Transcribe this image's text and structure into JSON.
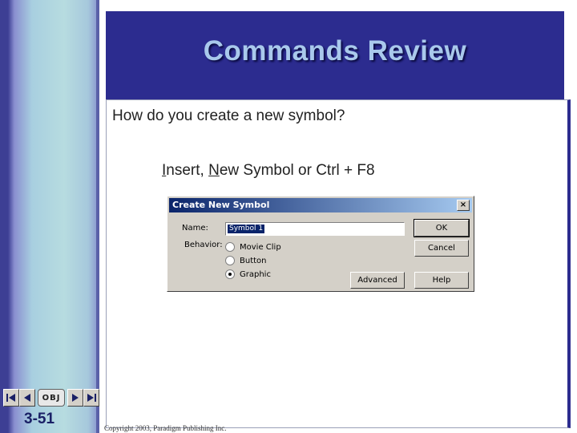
{
  "slide": {
    "title": "Commands Review",
    "question": "How do you create a new symbol?",
    "answer": {
      "part1_underlined": "I",
      "part1_rest": "nsert, ",
      "part2_underlined": "N",
      "part2_rest": "ew Symbol or Ctrl + F8"
    },
    "slide_number": "3-51",
    "obj_label": "OBJ",
    "copyright": "Copyright 2003, Paradigm Publishing Inc."
  },
  "dialog": {
    "title": "Create New Symbol",
    "close_label": "×",
    "name_label": "Name:",
    "name_value": "Symbol 1",
    "behavior_label": "Behavior:",
    "options": [
      {
        "label": "Movie Clip",
        "selected": false
      },
      {
        "label": "Button",
        "selected": false
      },
      {
        "label": "Graphic",
        "selected": true
      }
    ],
    "ok_label": "OK",
    "cancel_label": "Cancel",
    "advanced_label": "Advanced",
    "help_label": "Help"
  },
  "icons": {
    "nav_first": "first-slide-icon",
    "nav_prev": "previous-slide-icon",
    "nav_next": "next-slide-icon",
    "nav_last": "last-slide-icon"
  },
  "colors": {
    "title_bar": "#2c2c8f",
    "title_text": "#a9c9ec",
    "dialog_title": "#0a246a"
  }
}
